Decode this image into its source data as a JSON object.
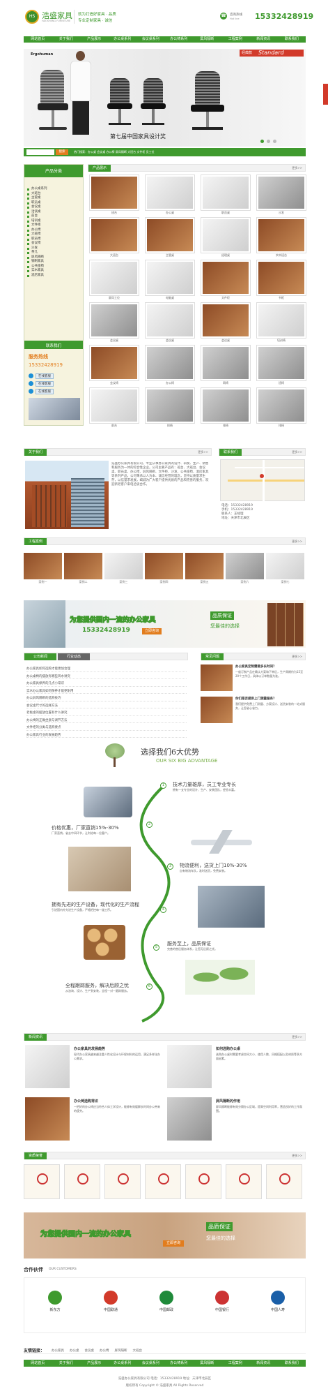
{
  "header": {
    "logo_mark": "HS",
    "brand_cn": "浩盛家具",
    "brand_en": "HAOSHENG FURNITURE",
    "slogan_1": "就为打造好家具 · 品质",
    "slogan_2": "专业定制家具 · 诚信",
    "hotline_label": "咨询热线",
    "hotline_sub": "Hot line",
    "phone": "15332428919"
  },
  "nav": [
    "网站首页",
    "关于我们",
    "产品展示",
    "办公桌系列",
    "会议桌系列",
    "办公椅系列",
    "屏风隔断",
    "工程案例",
    "新闻资讯",
    "联系我们"
  ],
  "banner": {
    "brand": "Ergohuman",
    "badge_top": "经典款",
    "badge_main": "Standard",
    "award": "第七届中国家具设计奖"
  },
  "search": {
    "placeholder": "",
    "button": "搜索",
    "hot": "热门搜索：办公桌 会议桌 办公椅 屏风隔断 大班台 文件柜 员工位"
  },
  "sidebar": {
    "title": "产品分类",
    "items": [
      "办公桌系列",
      "大班台",
      "主管桌",
      "职员桌",
      "会议桌",
      "洽谈桌",
      "前台",
      "培训桌",
      "文件柜",
      "办公椅",
      "大班椅",
      "职员椅",
      "会议椅",
      "沙发",
      "茶几",
      "屏风隔断",
      "钢制家具",
      "公共座椅",
      "实木家具",
      "酒店家具"
    ],
    "contact_title": "联系我们",
    "service_label": "服务热线",
    "service_phone": "15332428919",
    "qq": [
      "在线客服",
      "在线客服",
      "在线客服"
    ]
  },
  "products": {
    "title": "产品展示",
    "more": "更多>>",
    "items": [
      {
        "name": "班台",
        "tone": "wood"
      },
      {
        "name": "办公桌",
        "tone": "white"
      },
      {
        "name": "职员桌",
        "tone": "white"
      },
      {
        "name": "沙发",
        "tone": "grey"
      },
      {
        "name": "大班台",
        "tone": "wood"
      },
      {
        "name": "主管桌",
        "tone": "wood"
      },
      {
        "name": "经理桌",
        "tone": "white"
      },
      {
        "name": "实木班台",
        "tone": "wood"
      },
      {
        "name": "屏风工位",
        "tone": "white"
      },
      {
        "name": "电脑桌",
        "tone": "white"
      },
      {
        "name": "文件柜",
        "tone": "wood"
      },
      {
        "name": "书柜",
        "tone": "wood"
      },
      {
        "name": "会议桌",
        "tone": "grey"
      },
      {
        "name": "会议桌",
        "tone": "white"
      },
      {
        "name": "会议桌",
        "tone": "wood"
      },
      {
        "name": "培训椅",
        "tone": "white"
      },
      {
        "name": "会议椅",
        "tone": "wood"
      },
      {
        "name": "办公椅",
        "tone": "grey"
      },
      {
        "name": "网椅",
        "tone": "grey"
      },
      {
        "name": "班椅",
        "tone": "grey"
      },
      {
        "name": "前台",
        "tone": "white"
      },
      {
        "name": "排椅",
        "tone": "grey"
      },
      {
        "name": "排椅",
        "tone": "grey"
      },
      {
        "name": "排椅",
        "tone": "grey"
      }
    ]
  },
  "about": {
    "title": "关于我们",
    "more": "更多>>",
    "text": "浩盛办公家具有限公司，专业从事办公家具的设计、研发、生产、销售和服务为一体的综合性企业。公司主要产品有：班台、大班台、会议桌、职员桌、办公椅、屏风隔断、文件柜、沙发、公共座椅、酒店家具等系列产品。公司秉承以人为本、诚信经营的理念，坚持以质量求生存，以信誉求发展，竭诚为广大客户提供优质的产品和完善的服务，欢迎新老客户来电洽谈合作。"
  },
  "contact": {
    "title": "联系我们",
    "more": "更多>>",
    "lines": [
      "电话：15332428919",
      "手机：15332428919",
      "联系人：王经理",
      "地址：天津市北辰区"
    ]
  },
  "cases": {
    "title": "工程案例",
    "more": "更多>>",
    "items": [
      "案例一",
      "案例二",
      "案例三",
      "案例四",
      "案例五",
      "案例六",
      "案例七"
    ]
  },
  "promo": {
    "line": "为您提供国内一流的办公家具",
    "phone": "15332428919",
    "button": "立即咨询",
    "badge_1": "品质保证",
    "badge_2": "您最佳的选择"
  },
  "news": {
    "tab_active": "公司新闻",
    "tab_other": "行业动态",
    "items": [
      "办公家具如何选购才能更加合理",
      "办公桌椅的摆放有哪些风水讲究",
      "办公家具保养的几点小常识",
      "实木办公家具如何保养才能更耐用",
      "办公屏风隔断的选购技巧",
      "会议桌尺寸的选择方法",
      "老板桌的摆放位置有什么讲究",
      "办公椅的正确坐姿与调节方法",
      "文件柜的分类与选购要点",
      "办公家具行业的发展趋势"
    ]
  },
  "faq": {
    "title": "常见问题",
    "more": "更多>>",
    "items": [
      {
        "title": "办公家具定制需要多长时间？",
        "text": "一般订制产品在确认方案和下单后，生产周期约为15至20个工作日，具体以订单数量为准。"
      },
      {
        "title": "你们是否提供上门测量服务？",
        "text": "我们提供免费上门测量、方案设计、送货安装的一站式服务，让您省心省力。"
      }
    ]
  },
  "advantages": {
    "title": "选择我们6大优势",
    "subtitle": "OUR SIX BIG ADVANTAGE",
    "items": [
      {
        "no": "1",
        "title": "技术力量雄厚，员工专业专长",
        "text": "拥有一支专业的设计、生产、安装团队，经验丰富。"
      },
      {
        "no": "2",
        "title": "价格优惠，厂家直销15%-30%",
        "text": "厂家直销，省去中间环节，让利给每一位客户。"
      },
      {
        "no": "3",
        "title": "物流便利，送货上门10%-30%",
        "text": "自有物流车队，准时送货，免费安装。"
      },
      {
        "no": "4",
        "title": "拥有先进的生产设备，现代化的生产流程",
        "text": "引进国内外先进生产设备，严格把控每一道工序。"
      },
      {
        "no": "5",
        "title": "服务至上，品质保证",
        "text": "完善的售后服务体系，让您无后顾之忧。"
      },
      {
        "no": "6",
        "title": "全程跟踪服务，解决后顾之忧",
        "text": "从咨询、设计、生产到安装，全程一对一跟踪服务。"
      }
    ]
  },
  "news2": {
    "title": "新闻资讯",
    "more": "更多>>",
    "items": [
      {
        "title": "办公家具的发展趋势",
        "text": "现代办公家具越来越注重人性化设计与环保材料的运用，满足多样化办公需求。"
      },
      {
        "title": "如何选购办公桌",
        "text": "选购办公桌时需要考虑空间大小、使用人数、风格搭配以及材质等多方面因素。"
      },
      {
        "title": "办公椅选购常识",
        "text": "一把好的办公椅应当符合人体工学设计，能够有效缓解长时间办公带来的疲劳。"
      },
      {
        "title": "屏风隔断的作用",
        "text": "屏风隔断能够有效分隔办公区域，提高空间利用率，营造良好的工作氛围。"
      }
    ]
  },
  "certs": {
    "title": "资质荣誉",
    "more": "更多>>",
    "count": 7
  },
  "promo2": {
    "line": "为您提供国内一流的办公家具",
    "button": "立即咨询",
    "badge_1": "品质保证",
    "badge_2": "您最佳的选择"
  },
  "partners": {
    "title": "合作伙伴",
    "subtitle": "OUR CUSTOMERS",
    "items": [
      "新东方",
      "中国联通",
      "中国邮政",
      "中国银行",
      "中国人寿"
    ]
  },
  "links": {
    "label": "友情链接：",
    "items": [
      "办公家具",
      "办公桌",
      "会议桌",
      "办公椅",
      "屏风隔断",
      "大班台"
    ]
  },
  "footer": {
    "nav": [
      "网站首页",
      "关于我们",
      "产品展示",
      "办公桌系列",
      "会议桌系列",
      "办公椅系列",
      "屏风隔断",
      "工程案例",
      "新闻资讯",
      "联系我们"
    ],
    "line1": "浩盛办公家具有限公司 电话：15332428919 地址：天津市北辰区",
    "line2": "版权所有 Copyright © 浩盛家具 All Rights Reserved"
  },
  "colors": {
    "brand_green": "#3f9a2e",
    "accent_orange": "#e27d1e",
    "phone_green": "#3f9a2e"
  }
}
